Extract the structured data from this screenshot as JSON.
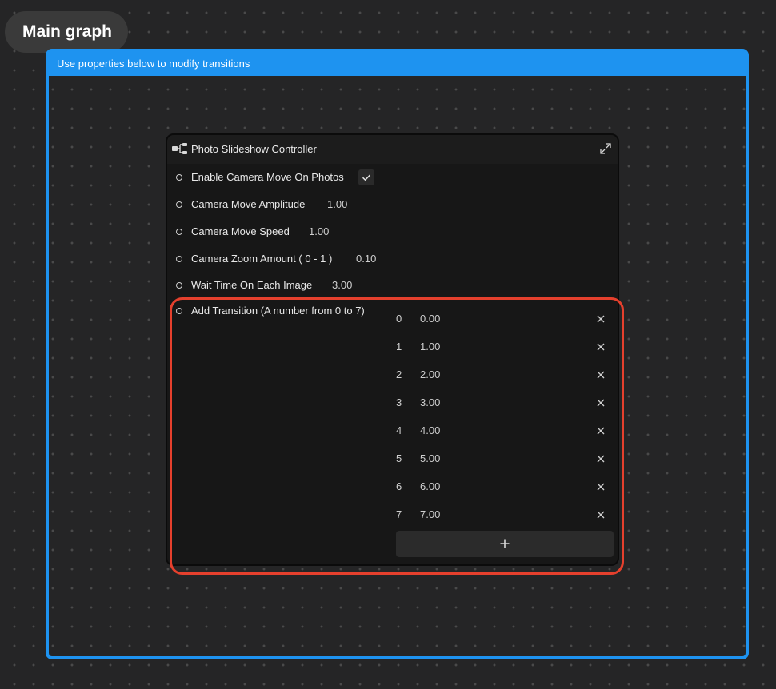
{
  "graph": {
    "title": "Main graph"
  },
  "group": {
    "header": "Use properties below to modify transitions",
    "color": "#1e93f0"
  },
  "node": {
    "icon": "node-graph-icon",
    "title": "Photo Slideshow Controller",
    "expand_icon": "expand-icon",
    "properties": {
      "enable_camera_move": {
        "label": "Enable Camera Move On Photos",
        "checked": true
      },
      "camera_move_amplitude": {
        "label": "Camera Move Amplitude",
        "value": "1.00"
      },
      "camera_move_speed": {
        "label": "Camera Move Speed",
        "value": "1.00"
      },
      "camera_zoom_amount": {
        "label": "Camera Zoom Amount ( 0 - 1 )",
        "value": "0.10"
      },
      "wait_time": {
        "label": "Wait Time On Each Image",
        "value": "3.00"
      },
      "add_transition": {
        "label": "Add Transition (A number from 0 to 7)",
        "items": [
          {
            "index": "0",
            "value": "0.00"
          },
          {
            "index": "1",
            "value": "1.00"
          },
          {
            "index": "2",
            "value": "2.00"
          },
          {
            "index": "3",
            "value": "3.00"
          },
          {
            "index": "4",
            "value": "4.00"
          },
          {
            "index": "5",
            "value": "5.00"
          },
          {
            "index": "6",
            "value": "6.00"
          },
          {
            "index": "7",
            "value": "7.00"
          }
        ],
        "add_icon": "plus-icon",
        "remove_icon": "close-icon"
      }
    }
  },
  "highlight_color": "#e5402d"
}
